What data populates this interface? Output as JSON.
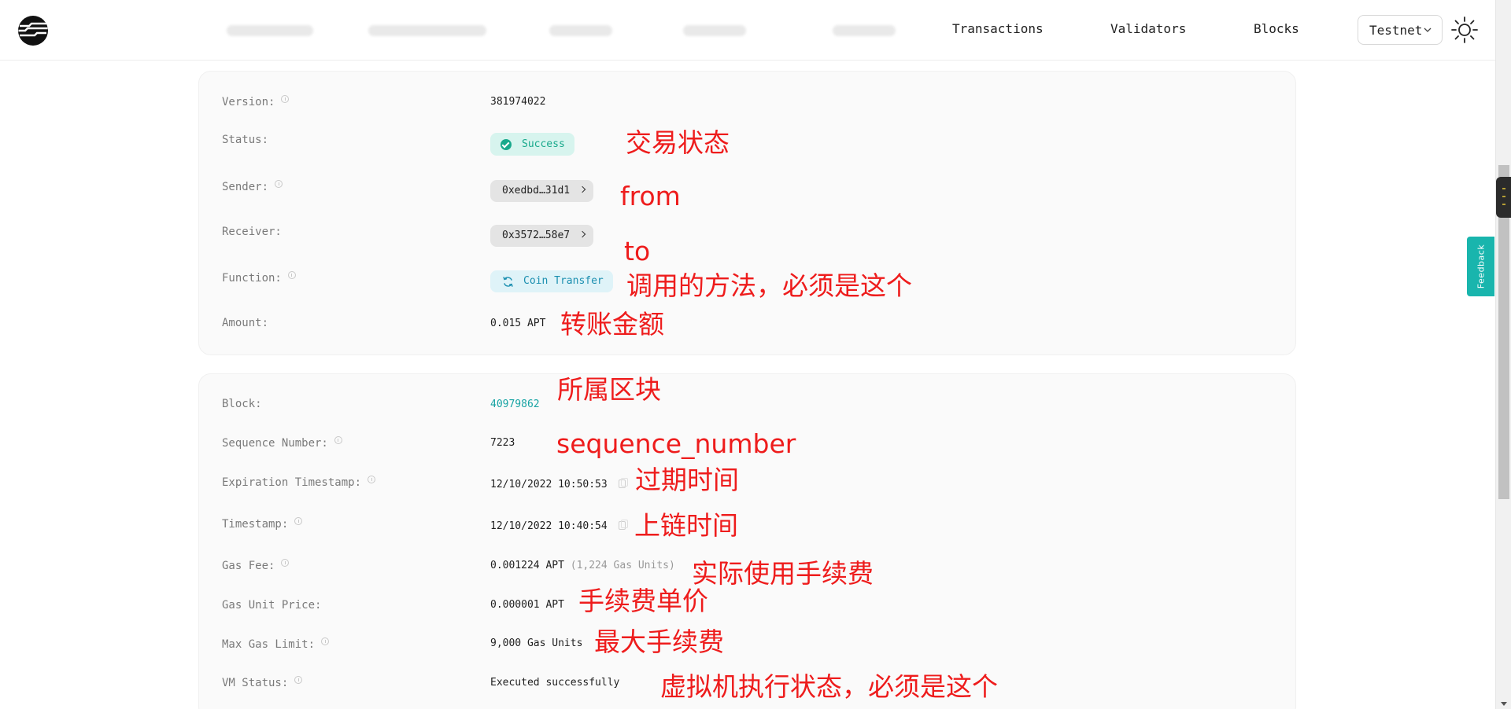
{
  "header": {
    "nav": {
      "transactions": "Transactions",
      "validators": "Validators",
      "blocks": "Blocks"
    },
    "network": "Testnet",
    "theme_icon": "sun-icon",
    "logo_icon": "aptos-logo-icon"
  },
  "feedback": {
    "label": "Feedback"
  },
  "summary": {
    "version": {
      "label": "Version:",
      "value": "381974022"
    },
    "status": {
      "label": "Status:",
      "value": "Success"
    },
    "sender": {
      "label": "Sender:",
      "value": "0xedbd…31d1"
    },
    "receiver": {
      "label": "Receiver:",
      "value": "0x3572…58e7"
    },
    "function": {
      "label": "Function:",
      "value": "Coin Transfer"
    },
    "amount": {
      "label": "Amount:",
      "value": "0.015 APT"
    }
  },
  "details": {
    "block": {
      "label": "Block:",
      "value": "40979862"
    },
    "sequence_number": {
      "label": "Sequence Number:",
      "value": "7223"
    },
    "expiration_timestamp": {
      "label": "Expiration Timestamp:",
      "value": "12/10/2022 10:50:53"
    },
    "timestamp": {
      "label": "Timestamp:",
      "value": "12/10/2022 10:40:54"
    },
    "gas_fee": {
      "label": "Gas Fee:",
      "value": "0.001224 APT",
      "units": "(1,224 Gas Units)"
    },
    "gas_unit_price": {
      "label": "Gas Unit Price:",
      "value": "0.000001 APT"
    },
    "max_gas_limit": {
      "label": "Max Gas Limit:",
      "value": "9,000 Gas Units"
    },
    "vm_status": {
      "label": "VM Status:",
      "value": "Executed successfully"
    }
  },
  "annotations": {
    "status": "交易状态",
    "sender": "from",
    "receiver": "to",
    "function": "调用的方法，必须是这个",
    "amount": "转账金额",
    "block": "所属区块",
    "sequence_number": "sequence_number",
    "expiration": "过期时间",
    "timestamp": "上链时间",
    "gas_fee": "实际使用手续费",
    "gas_unit_price": "手续费单价",
    "max_gas_limit": "最大手续费",
    "vm_status": "虚拟机执行状态，必须是这个"
  },
  "colors": {
    "accent": "#17a3a3",
    "annotation_red": "#ee1c1c",
    "success_bg": "#d7f4ee",
    "feedback_bg": "#19b5ad"
  }
}
